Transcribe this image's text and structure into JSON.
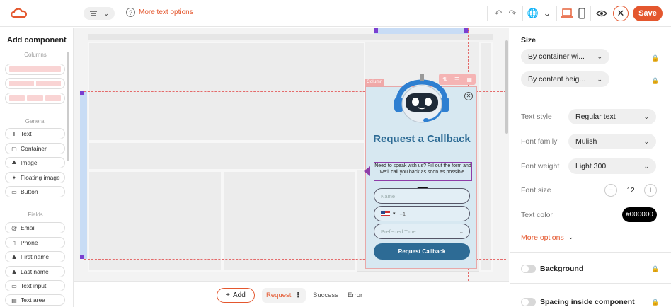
{
  "topbar": {
    "help_text": "More text options",
    "save_label": "Save"
  },
  "left_panel": {
    "title": "Add component",
    "sections": {
      "columns": "Columns",
      "general": "General",
      "fields": "Fields"
    },
    "general_items": [
      {
        "label": "Text",
        "icon": "text-icon"
      },
      {
        "label": "Container",
        "icon": "container-icon"
      },
      {
        "label": "Image",
        "icon": "image-icon"
      },
      {
        "label": "Floating image",
        "icon": "floating-image-icon"
      },
      {
        "label": "Button",
        "icon": "button-icon"
      }
    ],
    "field_items": [
      {
        "label": "Email",
        "icon": "at-icon"
      },
      {
        "label": "Phone",
        "icon": "phone-icon"
      },
      {
        "label": "First name",
        "icon": "person-icon"
      },
      {
        "label": "Last name",
        "icon": "person-icon"
      },
      {
        "label": "Text input",
        "icon": "text-input-icon"
      },
      {
        "label": "Text area",
        "icon": "text-area-icon"
      }
    ]
  },
  "canvas": {
    "column_tag": "Column",
    "form": {
      "title": "Request a Callback",
      "description": "Need to speak with us? Fill out the form and we'll call you back as soon as possible.",
      "name_placeholder": "Name",
      "phone_code": "+1",
      "time_placeholder": "Preferred Time",
      "cta_label": "Request Callback"
    }
  },
  "bottombar": {
    "add_label": "Add",
    "states": [
      "Request",
      "Success",
      "Error"
    ],
    "active_state": "Request"
  },
  "right_panel": {
    "size_heading": "Size",
    "width_option": "By container wi...",
    "height_option": "By content heig...",
    "text_style_label": "Text style",
    "text_style_value": "Regular text",
    "font_family_label": "Font family",
    "font_family_value": "Mulish",
    "font_weight_label": "Font weight",
    "font_weight_value": "Light 300",
    "font_size_label": "Font size",
    "font_size_value": "12",
    "text_color_label": "Text color",
    "text_color_value": "#000000",
    "more_options": "More options",
    "background_label": "Background",
    "spacing_label": "Spacing inside component"
  },
  "colors": {
    "accent": "#e4572e",
    "form_primary": "#2d6b95",
    "form_bg": "#d7e8f1"
  }
}
